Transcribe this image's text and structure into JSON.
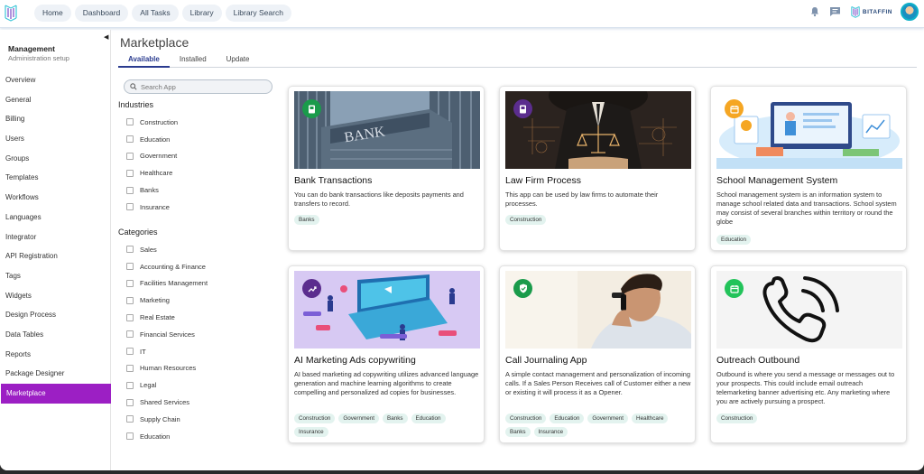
{
  "topbar": {
    "logo_icon": "app-logo-icon",
    "nav": [
      "Home",
      "Dashboard",
      "All Tasks",
      "Library",
      "Library Search"
    ],
    "icons": [
      "bell-icon",
      "chat-icon"
    ],
    "brand": "BITAFFIN"
  },
  "sidebar": {
    "title": "Management",
    "subtitle": "Administration setup",
    "items": [
      "Overview",
      "General",
      "Billing",
      "Users",
      "Groups",
      "Templates",
      "Workflows",
      "Languages",
      "Integrator",
      "API Registration",
      "Tags",
      "Widgets",
      "Design Process",
      "Data Tables",
      "Reports",
      "Package Designer",
      "Marketplace"
    ],
    "active": "Marketplace",
    "active_color": "#9c1fc4"
  },
  "main": {
    "title": "Marketplace",
    "tabs": [
      "Available",
      "Installed",
      "Update"
    ],
    "active_tab": "Available"
  },
  "filters": {
    "search_placeholder": "Search App",
    "industries_title": "Industries",
    "industries": [
      "Construction",
      "Education",
      "Government",
      "Healthcare",
      "Banks",
      "Insurance"
    ],
    "categories_title": "Categories",
    "categories": [
      "Sales",
      "Accounting & Finance",
      "Facilities Management",
      "Marketing",
      "Real Estate",
      "Financial Services",
      "IT",
      "Human Resources",
      "Legal",
      "Shared Services",
      "Supply Chain",
      "Education"
    ]
  },
  "apps": [
    {
      "title": "Bank Transactions",
      "desc": "You can do bank transactions like deposits payments and transfers to record.",
      "tags": [
        "Banks"
      ],
      "badge_color": "#1a9b4b",
      "badge_icon": "book-icon",
      "image": "BANK"
    },
    {
      "title": "Law Firm Process",
      "desc": "This app can be used by law firms to automate their processes.",
      "tags": [
        "Construction"
      ],
      "badge_color": "#5b2d8e",
      "badge_icon": "book-icon"
    },
    {
      "title": "School Management System",
      "desc": "School management system is an information system to manage school related data and transactions. School system may consist of several branches within territory or round the globe",
      "tags": [
        "Education"
      ],
      "badge_color": "#f5a623",
      "badge_icon": "calendar-icon"
    },
    {
      "title": "AI Marketing Ads copywriting",
      "desc": "AI based marketing ad copywriting utilizes advanced language generation and machine learning algorithms to create compelling and personalized ad copies for businesses.",
      "tags": [
        "Construction",
        "Government",
        "Banks",
        "Education",
        "Insurance"
      ],
      "badge_color": "#5b2d8e",
      "badge_icon": "chart-icon"
    },
    {
      "title": "Call Journaling App",
      "desc": "A simple contact management and personalization of incoming calls. If a Sales Person Receives call of Customer either a new or existing it will process it as a Opener.",
      "tags": [
        "Construction",
        "Education",
        "Government",
        "Healthcare",
        "Banks",
        "Insurance"
      ],
      "badge_color": "#1a9b4b",
      "badge_icon": "shield-check-icon"
    },
    {
      "title": "Outreach Outbound",
      "desc": "Outbound is where you send a message or messages out to your prospects. This could include email outreach telemarketing banner advertising etc. Any marketing where you are actively pursuing a prospect.",
      "tags": [
        "Construction"
      ],
      "badge_color": "#22c35a",
      "badge_icon": "calendar-icon"
    }
  ]
}
